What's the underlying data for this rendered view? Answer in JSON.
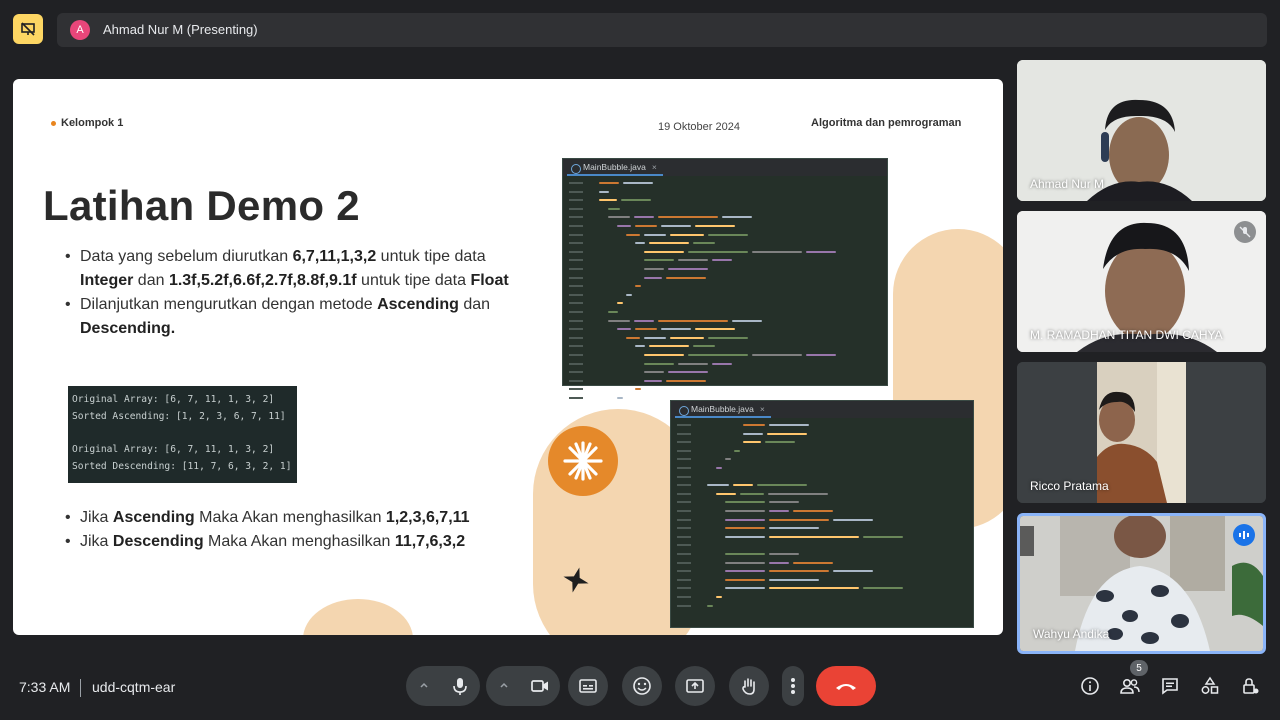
{
  "presenter": {
    "avatar_initial": "A",
    "label": "Ahmad Nur M (Presenting)"
  },
  "slide": {
    "group": "Kelompok 1",
    "date": "19 Oktober 2024",
    "subject": "Algoritma dan pemrograman",
    "title": "Latihan Demo 2",
    "bullet1": {
      "t1": "Data yang sebelum diurutkan ",
      "b1": "6,7,11,1,3,2",
      "t2": " untuk tipe data ",
      "b2": "Integer",
      "t3": " dan ",
      "b3": "1.3f,5.2f,6.6f,2.7f,8.8f,9.1f",
      "t4": " untuk tipe data ",
      "b4": "Float"
    },
    "bullet2": {
      "t1": "Dilanjutkan mengurutkan dengan metode ",
      "b1": "Ascending",
      "t2": " dan ",
      "b2": "Descending."
    },
    "console": {
      "line1": "Original Array: [6, 7, 11, 1, 3, 2]",
      "line2": "Sorted Ascending: [1, 2, 3, 6, 7, 11]",
      "line3": "Original Array: [6, 7, 11, 1, 3, 2]",
      "line4": "Sorted Descending: [11, 7, 6, 3, 2, 1]"
    },
    "bullet3": {
      "t1": "Jika ",
      "b1": "Ascending",
      "t2": " Maka Akan menghasilkan ",
      "b2": "1,2,3,6,7,11"
    },
    "bullet4": {
      "t1": "Jika ",
      "b1": "Descending",
      "t2": " Maka Akan menghasilkan ",
      "b2": "11,7,6,3,2"
    },
    "ide1_tab": "MainBubble.java",
    "ide2_tab": "MainBubble.java",
    "close_glyph": "×",
    "colors": {
      "accent_orange": "#e5892a",
      "decor_peach": "#f4d6b0",
      "ide_bg": "#253029"
    }
  },
  "participants": [
    {
      "name": "Ahmad Nur M",
      "muted": false
    },
    {
      "name": "M. RAMADHAN TITAN DWI CAHYA",
      "muted": true
    },
    {
      "name": "Ricco Pratama",
      "muted": false
    },
    {
      "name": "Wahyu Andika",
      "muted": false,
      "speaking": true
    }
  ],
  "bottom": {
    "time": "7:33 AM",
    "meeting_code": "udd-cqtm-ear",
    "participant_count": "5",
    "icons": [
      "mic-icon",
      "camera-icon",
      "captions-icon",
      "emoji-icon",
      "present-screen-icon",
      "raise-hand-icon",
      "more-options-icon",
      "end-call-icon",
      "info-icon",
      "people-icon",
      "chat-icon",
      "activities-icon",
      "host-controls-icon"
    ],
    "end_call_color": "#ea4335"
  }
}
